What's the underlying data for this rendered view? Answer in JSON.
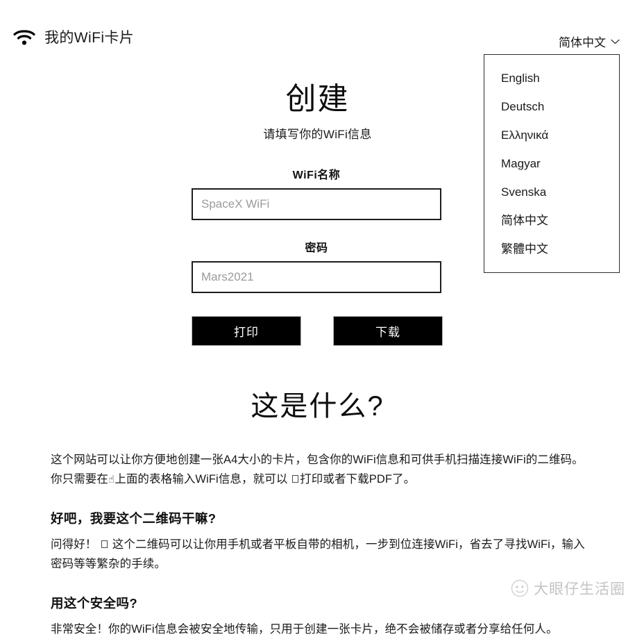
{
  "header": {
    "brand_title": "我的WiFi卡片",
    "wifi_icon": "wifi-icon",
    "language_current": "简体中文",
    "chevron_icon": "chevron-down-icon"
  },
  "language_menu": {
    "open": true,
    "items": [
      {
        "label": "English"
      },
      {
        "label": "Deutsch"
      },
      {
        "label": "Ελληνικά"
      },
      {
        "label": "Magyar"
      },
      {
        "label": "Svenska"
      },
      {
        "label": "简体中文"
      },
      {
        "label": "繁體中文"
      }
    ]
  },
  "create": {
    "title": "创建",
    "subtitle": "请填写你的WiFi信息",
    "ssid_label": "WiFi名称",
    "ssid_placeholder": "SpaceX WiFi",
    "ssid_value": "",
    "password_label": "密码",
    "password_placeholder": "Mars2021",
    "password_value": "",
    "print_button": "打印",
    "download_button": "下载"
  },
  "info": {
    "title": "这是什么?",
    "paragraph_1_part_a": "这个网站可以让你方便地创建一张A4大小的卡片，包含你的WiFi信息和可供手机扫描连接WiFi的二维码。你只需要在",
    "paragraph_1_hand_glyph": "☝",
    "paragraph_1_part_b": "上面的表格输入WiFi信息，就可以",
    "paragraph_1_part_c": "打印或者下载PDF了。",
    "subheading_1": "好吧，我要这个二维码干嘛?",
    "paragraph_2_part_a": "问得好！",
    "paragraph_2_part_b": "这个二维码可以让你用手机或者平板自带的相机，一步到位连接WiFi，省去了寻找WiFi，输入密码等等繁杂的手续。",
    "subheading_2": "用这个安全吗?",
    "paragraph_3": "非常安全！你的WiFi信息会被安全地传输，只用于创建一张卡片，绝不会被储存或者分享给任何人。"
  },
  "watermark": {
    "text": "大眼仔生活圈",
    "logo_icon": "circle-face-logo-icon"
  },
  "colors": {
    "page_bg": "#ffffff",
    "text": "#1a1a1a",
    "button_bg": "#000000",
    "button_text": "#ffffff",
    "input_border": "#1c1c1c",
    "placeholder": "#9b9b9b",
    "watermark": "#8d8d8d"
  }
}
